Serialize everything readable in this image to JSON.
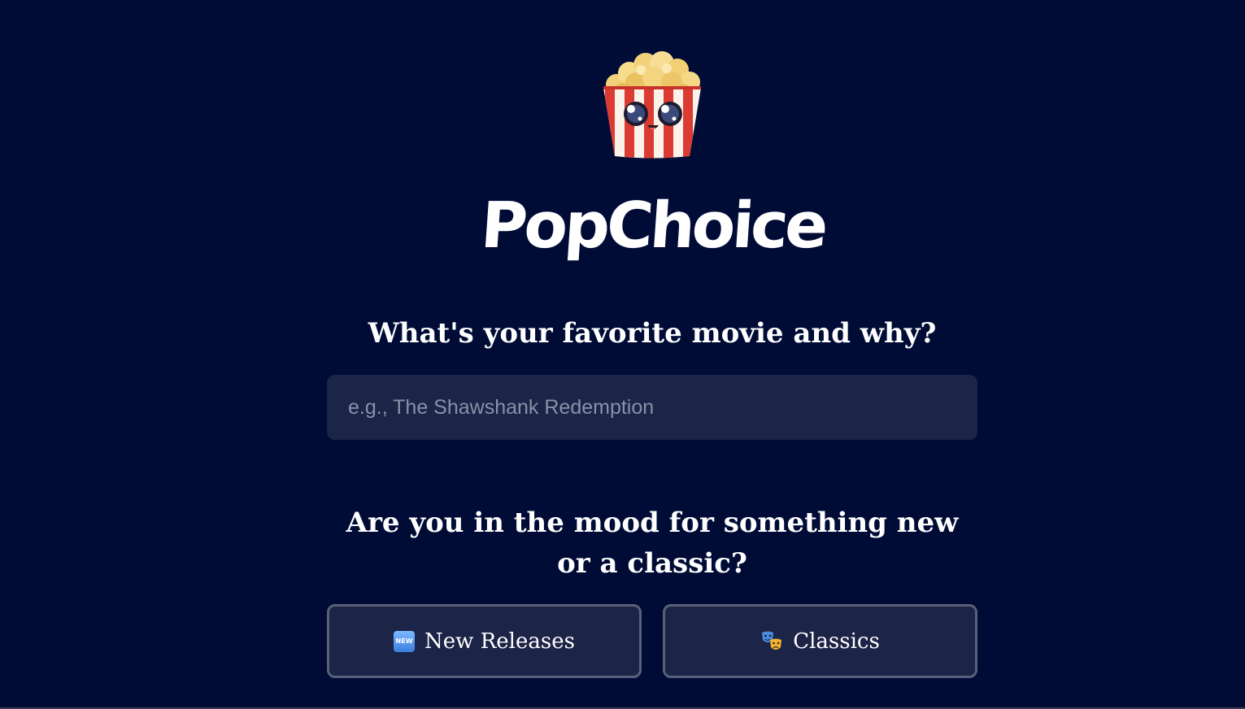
{
  "app": {
    "brand_name": "PopChoice",
    "mascot_icon": "popcorn-mascot-icon"
  },
  "form": {
    "favorite_question": "What's your favorite movie and why?",
    "favorite_placeholder": "e.g., The Shawshank Redemption",
    "favorite_value": "",
    "mood_question": "Are you in the mood for something new or a classic?",
    "options": [
      {
        "label": "New Releases",
        "badge_text": "NEW",
        "icon": "new-badge-icon",
        "selected": false
      },
      {
        "label": "Classics",
        "icon": "theater-masks-icon",
        "selected": false
      }
    ]
  },
  "colors": {
    "background": "#000c36",
    "field": "#1c2447",
    "button_border": "#59607a",
    "text": "#ffffff",
    "placeholder": "#8a90a6"
  }
}
